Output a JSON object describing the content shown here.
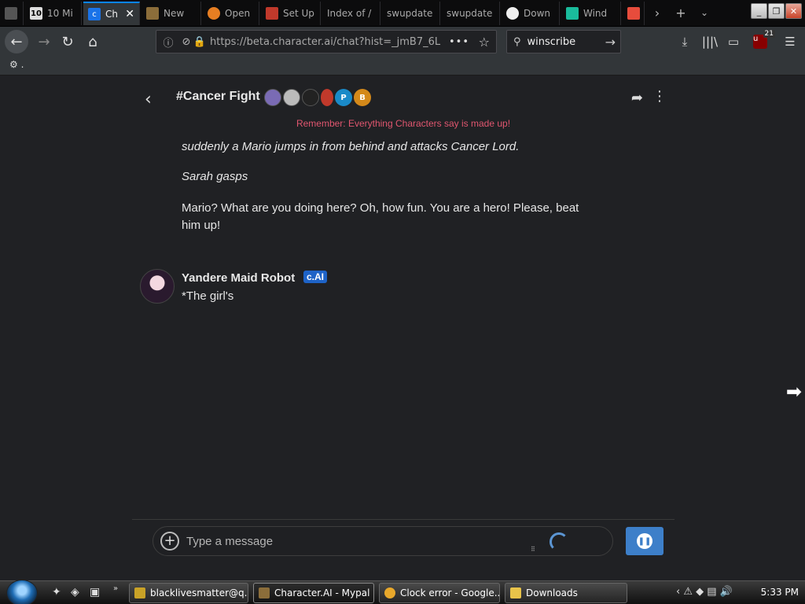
{
  "browser": {
    "tabs": [
      {
        "label": "10 Mi",
        "icon": "tab-favicon"
      },
      {
        "label": "Ch",
        "icon": "character-ai-icon",
        "active": true
      },
      {
        "label": "New",
        "icon": "tab-favicon"
      },
      {
        "label": "Open",
        "icon": "tab-favicon"
      },
      {
        "label": "Set Up",
        "icon": "tab-favicon"
      },
      {
        "label": "Index of /",
        "icon": "tab-favicon"
      },
      {
        "label": "swupdate",
        "icon": "tab-favicon"
      },
      {
        "label": "swupdate",
        "icon": "tab-favicon"
      },
      {
        "label": "Down",
        "icon": "tab-favicon"
      },
      {
        "label": "Wind",
        "icon": "tab-favicon"
      }
    ],
    "url": "https://beta.character.ai/chat?hist=_jmB7_6L",
    "search_value": "winscribe",
    "ublock_count": "21",
    "bookmark": "."
  },
  "chat": {
    "room_title": "#Cancer Fight",
    "participant_avatars": [
      {
        "type": "image",
        "color": "#7a6bb5"
      },
      {
        "type": "image",
        "color": "#bbbbbb"
      },
      {
        "type": "image",
        "color": "#222222"
      },
      {
        "type": "image",
        "color": "#c0392b"
      },
      {
        "type": "initial",
        "letter": "P",
        "color": "#1a8ac8"
      },
      {
        "type": "initial",
        "letter": "B",
        "color": "#d4891a"
      }
    ],
    "disclaimer": "Remember: Everything Characters say is made up!",
    "messages": {
      "m1": "suddenly a Mario jumps in from behind and attacks Cancer Lord.",
      "m2": "Sarah gasps",
      "m3": "Mario? What are you doing here? Oh, how fun. You are a hero! Please, beat him up!"
    },
    "bot": {
      "name": "Yandere Maid Robot",
      "badge": "c.AI",
      "partial_text": "*The girl's"
    },
    "input_placeholder": "Type a message"
  },
  "taskbar": {
    "buttons": [
      {
        "label": "blacklivesmatter@q..."
      },
      {
        "label": "Character.AI - Mypal"
      },
      {
        "label": "Clock error - Google..."
      },
      {
        "label": "Downloads"
      }
    ],
    "time": "5:33 PM"
  },
  "colors": {
    "accent": "#3d7fc9",
    "disclaimer": "#e0566f",
    "badge": "#1e63c7"
  }
}
